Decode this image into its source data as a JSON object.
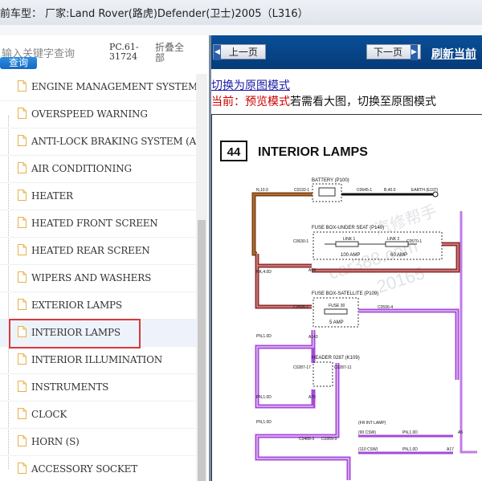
{
  "title": "前车型：  厂家:Land Rover(路虎)Defender(卫士)2005（L316）",
  "search": {
    "placeholder": "输入关键字查询",
    "button_label": "查询",
    "code": "PC.61-31724",
    "collapse_all": "折叠全部"
  },
  "tree": {
    "items": [
      {
        "label": "ENGINE MANAGEMENT SYSTEM"
      },
      {
        "label": "OVERSPEED WARNING"
      },
      {
        "label": "ANTI-LOCK BRAKING SYSTEM (AB"
      },
      {
        "label": "AIR CONDITIONING"
      },
      {
        "label": "HEATER"
      },
      {
        "label": "HEATED FRONT SCREEN"
      },
      {
        "label": "HEATED REAR SCREEN"
      },
      {
        "label": "WIPERS AND WASHERS"
      },
      {
        "label": "EXTERIOR LAMPS"
      },
      {
        "label": "INTERIOR LAMPS"
      },
      {
        "label": "INTERIOR ILLUMINATION"
      },
      {
        "label": "INSTRUMENTS"
      },
      {
        "label": "CLOCK"
      },
      {
        "label": "HORN (S)"
      },
      {
        "label": "ACCESSORY SOCKET"
      }
    ],
    "selected_index": 9
  },
  "nav": {
    "prev_label": "上一页",
    "next_label": "下一页",
    "refresh_label": "刷新当前"
  },
  "mode": {
    "switch_link": "切换为原图模式",
    "current_prefix": "当前：预览模式",
    "current_suffix": "若需看大图，切换至原图模式"
  },
  "diagram": {
    "page_number": "44",
    "title": "INTERIOR LAMPS",
    "labels": {
      "battery": "BATTERY (P100)",
      "earth": "EARTH (E107)",
      "n10": "N,10.0",
      "c0192": "C0192-1",
      "c0645": "C0645-1",
      "b40": "B,40.0",
      "fuse_seat": "FUSE BOX-UNDER SEAT (P140)",
      "c0630": "C0630-1",
      "link1": "LINK 1",
      "link2": "LINK 2",
      "c0570": "C0570-1",
      "amp100": "100 AMP",
      "amp60": "60 AMP",
      "nk40": "NK,4.0D",
      "a64": "A64",
      "fuse_sat": "FUSE BOX-SATELLITE (P109)",
      "c0595": "C0595-1",
      "fuse30": "FUSE 30",
      "c0596": "C0596-4",
      "amp5": "5 AMP",
      "pn10a": "PN,1.0D",
      "a143": "A143",
      "header": "HEADER 0287 (K109)",
      "c0287_17": "C0287-17",
      "c0287_11": "C0287-11",
      "pn10b": "PN,1.0D",
      "a79": "A79",
      "pn10c": "PN,1.0D",
      "fr_int_lamp": "(FR INT LAMP)",
      "c0488": "C0488-3",
      "c0359": "C0359-3",
      "csw90": "(90 CSW)",
      "csw110": "(110 CSW)",
      "a5": "A5",
      "a17": "A17",
      "pn10d": "PN,1.0D",
      "pn10e": "PN,1.0D"
    }
  },
  "watermark": {
    "line1": "汽修帮手",
    "line2": "car388.com",
    "line3": "20165"
  },
  "colors": {
    "nav_bar": "#053b78",
    "selection_border": "#d9383a",
    "wire_brown": "#7a3f17",
    "wire_red_brown": "#8e2f2f",
    "wire_purple": "#a64ad9",
    "link_blue": "#1a1aa8",
    "mode_red": "#cc0000"
  }
}
